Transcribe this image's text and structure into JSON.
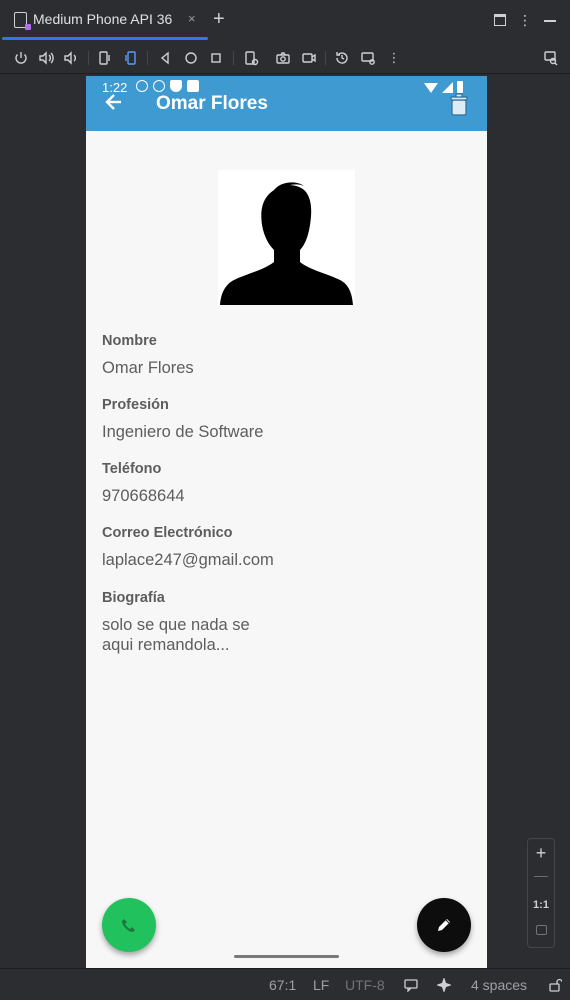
{
  "ide": {
    "tab_title": "Medium Phone API 36",
    "tab_close": "×",
    "tab_add": "+",
    "more": "⋮"
  },
  "toolbar": {
    "icons": [
      "power-icon",
      "volume-up-icon",
      "volume-down-icon",
      "rotate-left-icon",
      "rotate-right-icon",
      "back-icon",
      "home-icon",
      "overview-icon",
      "screenshot-icon",
      "camera-icon",
      "record-icon",
      "snapshot-icon",
      "settings-icon",
      "more-icon",
      "inspect-icon"
    ]
  },
  "phone": {
    "status_time": "1:22",
    "app_title": "Omar Flores",
    "fields": [
      {
        "label": "Nombre",
        "value": "Omar Flores"
      },
      {
        "label": "Profesión",
        "value": "Ingeniero de Software"
      },
      {
        "label": "Teléfono",
        "value": "970668644"
      },
      {
        "label": "Correo Electrónico",
        "value": "laplace247@gmail.com"
      },
      {
        "label": "Biografía",
        "value_line1": "solo se que nada se",
        "value_line2": "aqui remandola..."
      }
    ]
  },
  "zoom": {
    "zoom_in": "+",
    "zoom_out": "—",
    "actual_size": "1:1"
  },
  "statusbar": {
    "position": "67:1",
    "line_ending": "LF",
    "encoding": "UTF-8",
    "indent": "4 spaces"
  },
  "colors": {
    "appbar": "#3e9ad0",
    "call_fab": "#21c25e",
    "edit_fab": "#0d0d0d",
    "tab_accent": "#3574f0"
  }
}
